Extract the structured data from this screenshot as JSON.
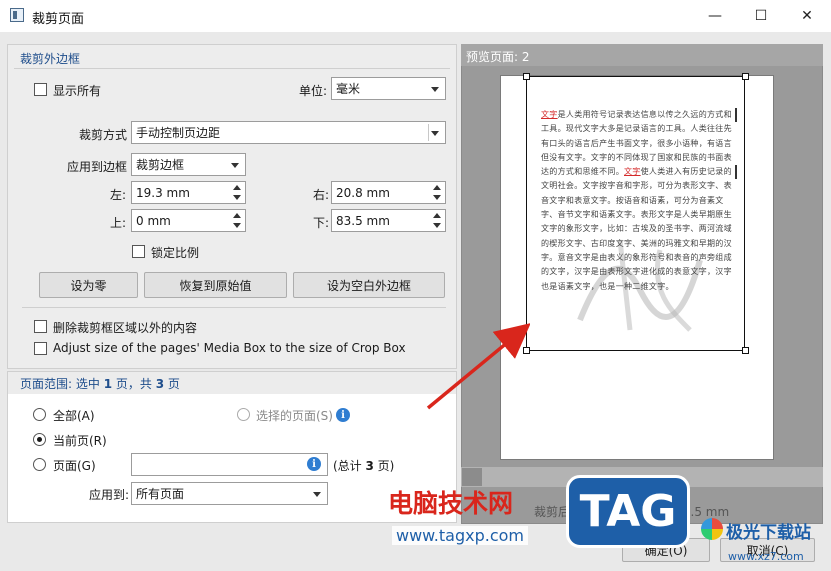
{
  "window": {
    "title": "裁剪页面",
    "minimize": "—",
    "maximize": "☐",
    "close": "✕"
  },
  "crop_group": {
    "title": "裁剪外边框",
    "show_all_label": "显示所有",
    "show_all_checked": false,
    "unit_label": "单位:",
    "unit_value": "毫米",
    "crop_mode_label": "裁剪方式",
    "crop_mode_value": "手动控制页边距",
    "apply_to_box_label": "应用到边框",
    "apply_to_box_value": "裁剪边框",
    "left_label": "左:",
    "left_value": "19.3 mm",
    "right_label": "右:",
    "right_value": "20.8 mm",
    "top_label": "上:",
    "top_value": "0 mm",
    "bottom_label": "下:",
    "bottom_value": "83.5 mm",
    "lock_ratio_label": "锁定比例",
    "lock_ratio_checked": false,
    "btn_zero": "设为零",
    "btn_restore": "恢复到原始值",
    "btn_white_margin": "设为空白外边框",
    "delete_outside_label": "删除裁剪框区域以外的内容",
    "adjust_media_label": "Adjust size of the pages' Media Box to the size of Crop Box"
  },
  "range_group": {
    "title_prefix": "页面范围: 选中 ",
    "selected_count": "1",
    "title_mid": " 页，共 ",
    "total_count": "3",
    "title_suffix": " 页",
    "all_label": "全部(A)",
    "selected_pages_label": "选择的页面(S)",
    "current_page_label": "当前页(R)",
    "pages_label": "页面(G)",
    "pages_input_value": "",
    "total_prefix": "(总计 ",
    "total_pages": "3",
    "total_suffix": " 页)",
    "apply_to_label": "应用到:",
    "apply_to_value": "所有页面",
    "selected_option": "current"
  },
  "preview": {
    "title": "预览页面: 2",
    "status_prefix": "裁剪后的页面大",
    "status_value": "69.9 ... 213.5 mm"
  },
  "footer": {
    "ok_label": "确定(O)",
    "cancel_label": "取消(C)"
  },
  "document_text": {
    "highlight_1": "文字",
    "para_1": "是人类用符号记录表达信息以传之久远的方式和工具。现代文字大多是记录语言的工具。人类往往先有口头的语言后产生书面文字，很多小语种，有语言但没有文字。文字的不同体现了国家和民族的书面表达的方式和思维不同。",
    "highlight_2": "文字",
    "para_2": "使人类进入有历史记录的文明社会。文字按字音和字形，可分为表形文字、表音文字和表意文字。按语音和语素，可分为音素文字、音节文字和语素文字。表形文字是人类早期原生文字的象形文字，比如：古埃及的圣书字、两河流域的楔形文字、古印度文字、美洲的玛雅文和早期的汉字。意音文字是由表义的象形符号和表音的声旁组成的文字，汉字是由表形文字进化成的表意文字，汉字也是语素文字，也是一种二维文字。"
  },
  "watermark": {
    "site_name": "电脑技术网",
    "site_url": "www.tagxp.com",
    "tag_logo": "TAG",
    "download_site": "极光下载站",
    "download_url": "www.xz7.com",
    "brand_color": "#1e5fa8",
    "red_color": "#d9261c"
  },
  "colors": {
    "group_title": "#1f4e8c",
    "accent_info": "#2f7dd1"
  }
}
